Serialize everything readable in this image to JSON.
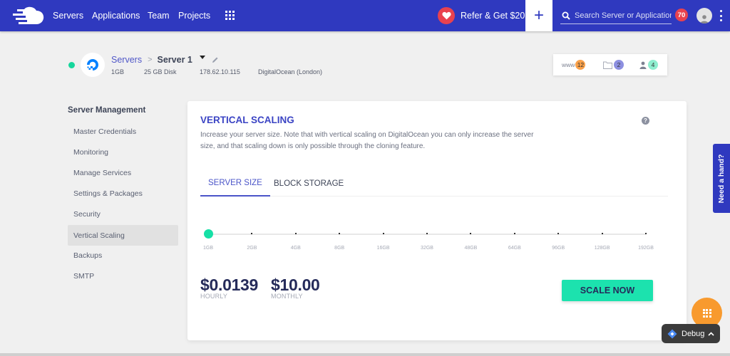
{
  "topbar": {
    "logo_icon": "cloudways-cloud-logo",
    "nav": [
      "Servers",
      "Applications",
      "Team",
      "Projects"
    ],
    "apps_icon": "grid-icon",
    "refer_label": "Refer & Get $20",
    "add_label": "+",
    "search_placeholder": "Search Server or Application",
    "notifications_count": "70",
    "avatar_icon": "user-icon",
    "menu_icon": "kebab-icon",
    "colors": {
      "bar": "#2f39bf",
      "badge": "#e9424f"
    }
  },
  "server": {
    "status": "running",
    "status_color": "#16d69c",
    "provider_icon": "digitalocean-logo",
    "breadcrumb_root": "Servers",
    "breadcrumb_sep": ">",
    "name": "Server 1",
    "size": "1GB",
    "disk": "25 GB Disk",
    "ip": "178.62.10.115",
    "location": "DigitalOcean (London)"
  },
  "counters": [
    {
      "label": "www",
      "icon": "www-icon",
      "value": "12",
      "color": "#f9a14a"
    },
    {
      "label": "",
      "icon": "folder-icon",
      "value": "2",
      "color": "#8c8fe0"
    },
    {
      "label": "",
      "icon": "user-icon",
      "value": "4",
      "color": "#8eeecf"
    }
  ],
  "sidebar": {
    "title": "Server Management",
    "items": [
      {
        "label": "Master Credentials",
        "active": false
      },
      {
        "label": "Monitoring",
        "active": false
      },
      {
        "label": "Manage Services",
        "active": false
      },
      {
        "label": "Settings & Packages",
        "active": false
      },
      {
        "label": "Security",
        "active": false
      },
      {
        "label": "Vertical Scaling",
        "active": true
      },
      {
        "label": "Backups",
        "active": false
      },
      {
        "label": "SMTP",
        "active": false
      }
    ]
  },
  "panel": {
    "title": "VERTICAL SCALING",
    "description": "Increase your server size. Note that with vertical scaling on DigitalOcean you can only increase the server size, and that scaling down is only possible through the cloning feature.",
    "help_label": "?",
    "tabs": [
      {
        "label": "SERVER SIZE",
        "active": true
      },
      {
        "label": "BLOCK STORAGE",
        "active": false
      }
    ],
    "slider": {
      "options": [
        "1GB",
        "2GB",
        "4GB",
        "8GB",
        "16GB",
        "32GB",
        "48GB",
        "64GB",
        "96GB",
        "128GB",
        "192GB"
      ],
      "selected_index": 0,
      "knob_color": "#16e0a6"
    },
    "hourly_price": "$0.0139",
    "hourly_label": "HOURLY",
    "monthly_price": "$10.00",
    "monthly_label": "MONTHLY",
    "scale_button": "SCALE NOW"
  },
  "help_tab": "Need a hand?",
  "fab_icon": "grid-icon",
  "debug": {
    "label": "Debug",
    "icon": "tag-manager-diamond-icon"
  }
}
